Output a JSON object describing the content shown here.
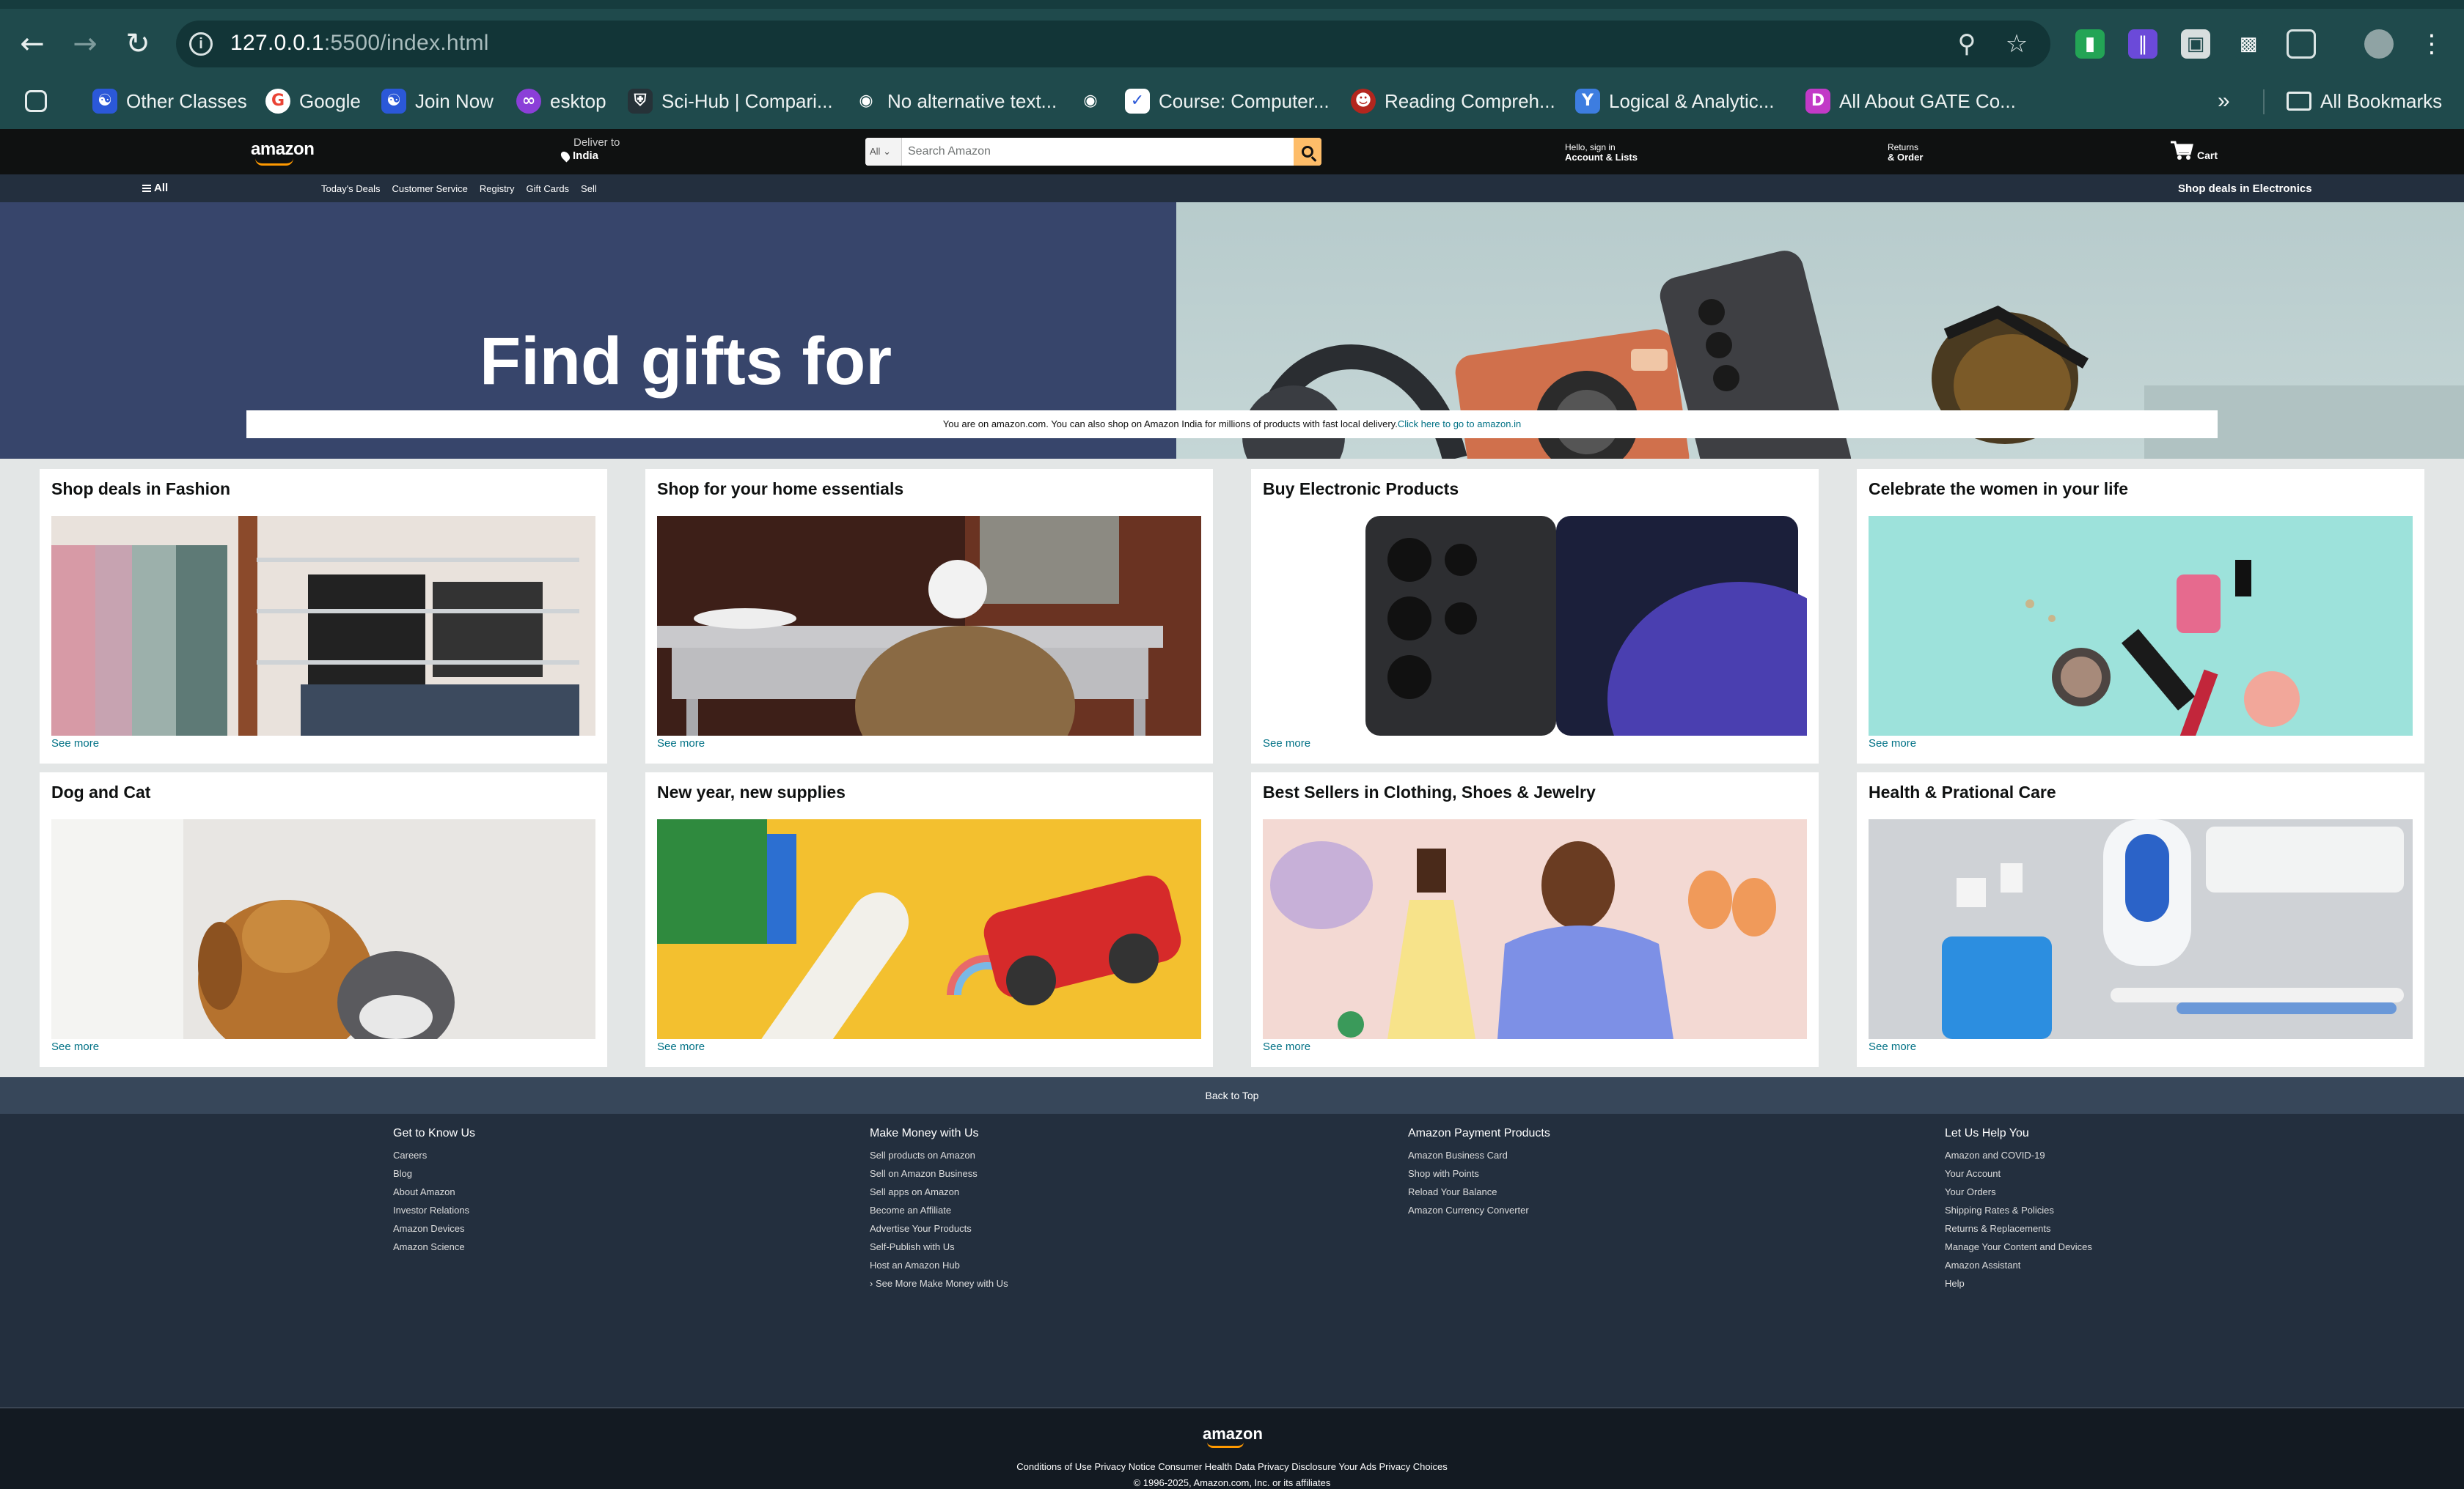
{
  "browser": {
    "url_host": "127.0.0.1",
    "url_path": ":5500/index.html",
    "bookmarks": [
      {
        "label": "",
        "icon": "apps-grid-icon"
      },
      {
        "label": "Other Classes",
        "icon": "people-icon"
      },
      {
        "label": "Google",
        "icon": "google-icon"
      },
      {
        "label": "Join Now",
        "icon": "people-icon"
      },
      {
        "label": "esktop",
        "icon": "chat-icon"
      },
      {
        "label": "Sci-Hub | Compari...",
        "icon": "shield-icon"
      },
      {
        "label": "No alternative text...",
        "icon": "globe-icon"
      },
      {
        "label": "",
        "icon": "globe-icon"
      },
      {
        "label": "Course: Computer...",
        "icon": "course-icon"
      },
      {
        "label": "Reading Compreh...",
        "icon": "reading-icon"
      },
      {
        "label": "Logical & Analytic...",
        "icon": "y-icon"
      },
      {
        "label": "All About GATE Co...",
        "icon": "d-icon"
      }
    ],
    "all_bookmarks": "All Bookmarks"
  },
  "header": {
    "logo": "amazon",
    "deliver_line1": "Deliver to",
    "deliver_line2": "India",
    "search_category": "All",
    "search_placeholder": "Search Amazon",
    "account_line1": "Hello, sign in",
    "account_line2": "Account & Lists",
    "returns_line1": "Returns",
    "returns_line2": "& Order",
    "cart_label": "Cart"
  },
  "subnav": {
    "all_label": "All",
    "links": [
      "Today's Deals",
      "Customer Service",
      "Registry",
      "Gift Cards",
      "Sell"
    ],
    "right_label": "Shop deals in Electronics"
  },
  "hero": {
    "title": "Find gifts for",
    "notice_text": "You are on amazon.com. You can also shop on Amazon India for millions of products with fast local delivery.",
    "notice_link": "Click here to go to amazon.in"
  },
  "cards": [
    {
      "title": "Shop deals in Fashion",
      "more": "See more"
    },
    {
      "title": "Shop for your home essentials",
      "more": "See more"
    },
    {
      "title": "Buy Electronic Products",
      "more": "See more"
    },
    {
      "title": "Celebrate the women in your life",
      "more": "See more"
    },
    {
      "title": "Dog and Cat",
      "more": "See more"
    },
    {
      "title": "New year, new supplies",
      "more": "See more"
    },
    {
      "title": "Best Sellers in Clothing, Shoes & Jewelry",
      "more": "See more"
    },
    {
      "title": "Health & Prational Care",
      "more": "See more"
    }
  ],
  "footer": {
    "back_to_top": "Back to Top",
    "columns": [
      {
        "title": "Get to Know Us",
        "items": [
          "Careers",
          "Blog",
          "About Amazon",
          "Investor Relations",
          "Amazon Devices",
          "Amazon Science"
        ]
      },
      {
        "title": "Make Money with Us",
        "items": [
          "Sell products on Amazon",
          "Sell on Amazon Business",
          "Sell apps on Amazon",
          "Become an Affiliate",
          "Advertise Your Products",
          "Self-Publish with Us",
          "Host an Amazon Hub",
          "› See More Make Money with Us"
        ]
      },
      {
        "title": "Amazon Payment Products",
        "items": [
          "Amazon Business Card",
          "Shop with Points",
          "Reload Your Balance",
          "Amazon Currency Converter"
        ]
      },
      {
        "title": "Let Us Help You",
        "items": [
          "Amazon and COVID-19",
          "Your Account",
          "Your Orders",
          "Shipping Rates & Policies",
          "Returns & Replacements",
          "Manage Your Content and Devices",
          "Amazon Assistant",
          "Help"
        ]
      }
    ],
    "bottom_logo": "amazon",
    "bottom_links": "Conditions of Use Privacy Notice Consumer Health Data Privacy Disclosure Your Ads Privacy Choices",
    "copyright": "© 1996-2025, Amazon.com, Inc. or its affiliates"
  },
  "colors": {
    "nav_bg": "#0f1111",
    "subnav_bg": "#232f3e",
    "link": "#007185",
    "accent": "#febd69",
    "hero_left": "#37456b",
    "footer_bg": "#232f3e"
  }
}
